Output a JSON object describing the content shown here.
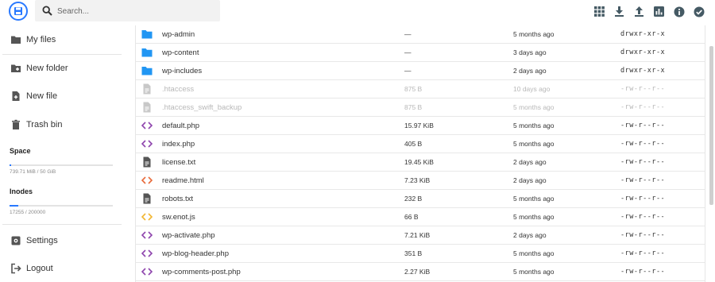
{
  "search": {
    "placeholder": "Search..."
  },
  "header_actions": [
    "grid-view-icon",
    "download-icon",
    "upload-icon",
    "chart-icon",
    "info-icon",
    "select-icon"
  ],
  "sidebar": {
    "items": [
      {
        "label": "My files",
        "icon": "folder-icon"
      },
      {
        "label": "New folder",
        "icon": "new-folder-icon"
      },
      {
        "label": "New file",
        "icon": "new-file-icon"
      },
      {
        "label": "Trash bin",
        "icon": "trash-icon"
      }
    ],
    "space": {
      "title": "Space",
      "value": "739.71 MiB / 50 GiB",
      "fraction": 0.015
    },
    "inodes": {
      "title": "Inodes",
      "value": "17255 / 200000",
      "fraction": 0.086
    },
    "bottom": [
      {
        "label": "Settings",
        "icon": "settings-icon"
      },
      {
        "label": "Logout",
        "icon": "logout-icon"
      }
    ]
  },
  "files": [
    {
      "name": "wp-admin",
      "size": "—",
      "modified": "5 months ago",
      "perms": "drwxr-xr-x",
      "type": "folder",
      "hidden": false
    },
    {
      "name": "wp-content",
      "size": "—",
      "modified": "3 days ago",
      "perms": "drwxr-xr-x",
      "type": "folder",
      "hidden": false
    },
    {
      "name": "wp-includes",
      "size": "—",
      "modified": "2 days ago",
      "perms": "drwxr-xr-x",
      "type": "folder",
      "hidden": false
    },
    {
      "name": ".htaccess",
      "size": "875 B",
      "modified": "10 days ago",
      "perms": "-rw-r--r--",
      "type": "file",
      "hidden": true
    },
    {
      "name": ".htaccess_swift_backup",
      "size": "875 B",
      "modified": "5 months ago",
      "perms": "-rw-r--r--",
      "type": "file",
      "hidden": true
    },
    {
      "name": "default.php",
      "size": "15.97 KiB",
      "modified": "5 months ago",
      "perms": "-rw-r--r--",
      "type": "php",
      "hidden": false
    },
    {
      "name": "index.php",
      "size": "405 B",
      "modified": "5 months ago",
      "perms": "-rw-r--r--",
      "type": "php",
      "hidden": false
    },
    {
      "name": "license.txt",
      "size": "19.45 KiB",
      "modified": "2 days ago",
      "perms": "-rw-r--r--",
      "type": "txt",
      "hidden": false
    },
    {
      "name": "readme.html",
      "size": "7.23 KiB",
      "modified": "2 days ago",
      "perms": "-rw-r--r--",
      "type": "html",
      "hidden": false
    },
    {
      "name": "robots.txt",
      "size": "232 B",
      "modified": "5 months ago",
      "perms": "-rw-r--r--",
      "type": "txt",
      "hidden": false
    },
    {
      "name": "sw.enot.js",
      "size": "66 B",
      "modified": "5 months ago",
      "perms": "-rw-r--r--",
      "type": "js",
      "hidden": false
    },
    {
      "name": "wp-activate.php",
      "size": "7.21 KiB",
      "modified": "2 days ago",
      "perms": "-rw-r--r--",
      "type": "php",
      "hidden": false
    },
    {
      "name": "wp-blog-header.php",
      "size": "351 B",
      "modified": "5 months ago",
      "perms": "-rw-r--r--",
      "type": "php",
      "hidden": false
    },
    {
      "name": "wp-comments-post.php",
      "size": "2.27 KiB",
      "modified": "5 months ago",
      "perms": "-rw-r--r--",
      "type": "php",
      "hidden": false
    }
  ],
  "colors": {
    "accent": "#2979ff",
    "folder": "#2196f3",
    "php": "#8e44ad",
    "html": "#e86a3a",
    "js": "#f2b632",
    "txt": "#555555",
    "hidden": "#c8c8c8"
  }
}
